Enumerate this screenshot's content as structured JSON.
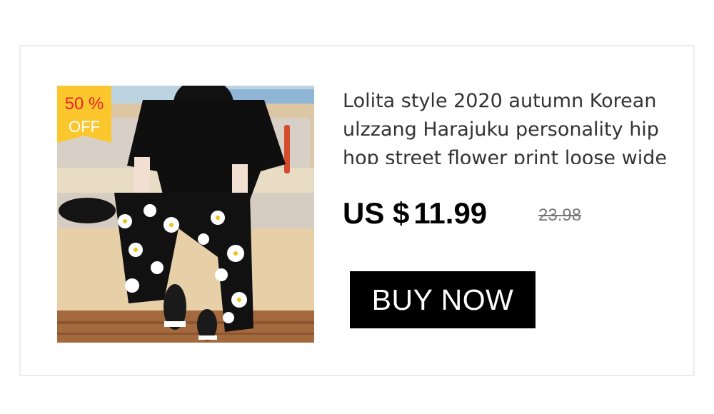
{
  "product": {
    "discount_percent": "50 %",
    "discount_off": "OFF",
    "title": "Lolita style 2020 autumn Korean ulzzang Harajuku personality hip hop street flower print loose wide",
    "price_currency": "US $",
    "price_value": "11.99",
    "old_price": "23.98",
    "buy_label": "BUY NOW",
    "photo_icon": "product-photo"
  },
  "colors": {
    "badge_bg": "#fcc62d",
    "badge_text": "#e8222a",
    "button_bg": "#000000",
    "button_text": "#ffffff"
  }
}
